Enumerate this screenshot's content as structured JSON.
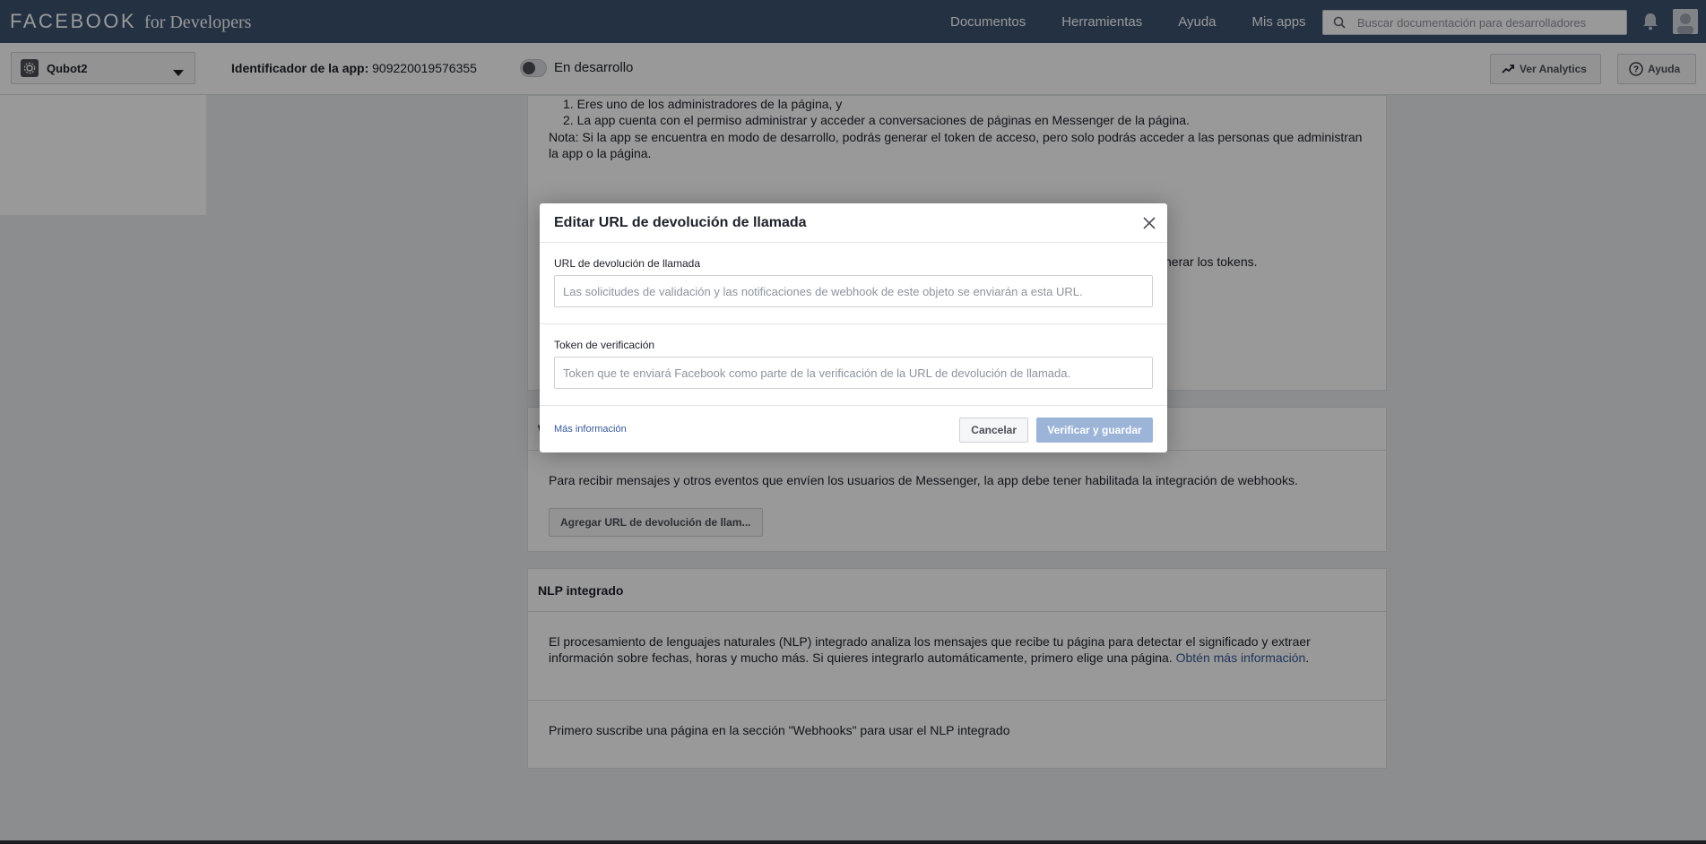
{
  "topbar": {
    "brand_main": "FACEBOOK",
    "brand_sub": "for Developers",
    "nav": [
      "Documentos",
      "Herramientas",
      "Ayuda",
      "Mis apps"
    ],
    "search_placeholder": "Buscar documentación para desarrolladores",
    "bg_color": "#3b5270"
  },
  "subbar": {
    "app_name": "Qubot2",
    "app_id_label": "Identificador de la app:",
    "app_id_value": "909220019576355",
    "mode_label": "En desarrollo",
    "analytics_button": "Ver Analytics",
    "help_button": "Ayuda"
  },
  "background": {
    "list_item_1": "1. Eres uno de los administradores de la página, y",
    "list_item_2": "2. La app cuenta con el permiso administrar y acceder a conversaciones de páginas en Messenger de la página.",
    "note": "Nota: Si la app se encuentra en modo de desarrollo, podrás generar el token de acceso, pero solo podrás acceder a las personas que administran la app o la página.",
    "partial_text": "nerar los tokens.",
    "webhooks_header_partial": "W",
    "webhooks_body": "Para recibir mensajes y otros eventos que envíen los usuarios de Messenger, la app debe tener habilitada la integración de webhooks.",
    "webhooks_button": "Agregar URL de devolución de llam...",
    "nlp_header": "NLP integrado",
    "nlp_body": "El procesamiento de lenguajes naturales (NLP) integrado analiza los mensajes que recibe tu página para detectar el significado y extraer información sobre fechas, horas y mucho más. Si quieres integrarlo automáticamente, primero elige una página.",
    "nlp_link": "Obtén más información",
    "nlp_footer": "Primero suscribe una página en la sección \"Webhooks\" para usar el NLP integrado"
  },
  "modal": {
    "title": "Editar URL de devolución de llamada",
    "callback_label": "URL de devolución de llamada",
    "callback_placeholder": "Las solicitudes de validación y las notificaciones de webhook de este objeto se enviarán a esta URL.",
    "token_label": "Token de verificación",
    "token_placeholder": "Token que te enviará Facebook como parte de la verificación de la URL de devolución de llamada.",
    "more_info": "Más información",
    "cancel": "Cancelar",
    "save": "Verificar y guardar"
  }
}
